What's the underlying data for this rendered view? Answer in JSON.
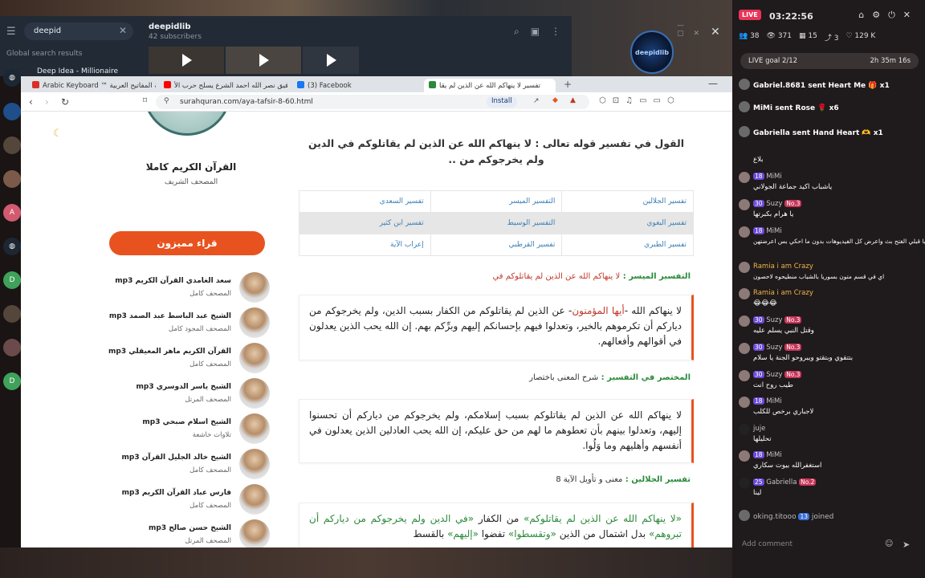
{
  "telegram": {
    "search_value": "deepid",
    "global_label": "Global search results",
    "result_title": "Deep Idea - Millionaire",
    "channel_name": "deepidlib",
    "subscribers": "42 subscribers",
    "logo_text": "deepidlib"
  },
  "browser": {
    "tabs": [
      {
        "label": "Arabic Keyboard ™ لوحة المفاتيح العربية",
        "color": "#d93025"
      },
      {
        "label": "رفيق نصر الله احمد الشرع يسلح حرب الأ",
        "color": "#ff0000"
      },
      {
        "label": "(3) Facebook",
        "color": "#1877f2"
      },
      {
        "label": "تفسير لا ينهاكم الله عن الذين لم يقا",
        "color": "#2a8a3a"
      }
    ],
    "url": "surahquran.com/aya-tafsir-8-60.html",
    "install_label": "Install"
  },
  "sidebar": {
    "title": "القرآن الكريم كاملا",
    "subtitle": "المصحف الشريف",
    "read_button": "قراء مميزون",
    "reciters": [
      {
        "name": "سعد الغامدي القرآن الكريم mp3",
        "desc": "المصحف كامل"
      },
      {
        "name": "الشيخ عبد الباسط عبد الصمد mp3",
        "desc": "المصحف المجود كامل"
      },
      {
        "name": "القرآن الكريم ماهر المعيقلي mp3",
        "desc": "المصحف كامل"
      },
      {
        "name": "الشيخ ياسر الدوسري mp3",
        "desc": "المصحف المرتل"
      },
      {
        "name": "الشيخ اسلام صبحي mp3",
        "desc": "تلاوات خاشعة"
      },
      {
        "name": "الشيخ خالد الجليل القرآن mp3",
        "desc": "المصحف كامل"
      },
      {
        "name": "فارس عباد القرآن الكريم mp3",
        "desc": "المصحف كامل"
      },
      {
        "name": "الشيخ حسن صالح mp3",
        "desc": "المصحف المرتل"
      }
    ]
  },
  "content": {
    "heading": "القول في تفسير قوله تعالى : لا ينهاكم الله عن الذين لم يقاتلوكم في الدين ولم يخرجوكم من ..",
    "table": [
      [
        "تفسير الجلالين",
        "التفسير الميسر",
        "تفسير السعدي"
      ],
      [
        "تفسير البغوي",
        "التفسير الوسيط",
        "تفسير ابن كثير"
      ],
      [
        "تفسير الطبري",
        "تفسير القرطبي",
        "إعراب الآية"
      ]
    ],
    "muyassar_label": "التفسير الميسر",
    "muyassar_desc": "لا ينهاكم الله عن الذين لم يقاتلوكم في",
    "muyassar_text_pre": "لا ينهاكم الله -",
    "muyassar_text_red": "أيها المؤمنون",
    "muyassar_text_post": "- عن الذين لم يقاتلوكم من الكفار بسبب الدين، ولم يخرجوكم من دياركم أن تكرموهم بالخير، وتعدلوا فيهم بإحسانكم إليهم وبرِّكم بهم. إن الله يحب الذين يعدلون في أقوالهم وأفعالهم.",
    "mukhtasar_label": "المختصر في التفسير",
    "mukhtasar_desc": "شرح المعنى باختصار",
    "mukhtasar_text": "لا ينهاكم الله عن الذين لم يقاتلوكم بسبب إسلامكم، ولم يخرجوكم من دياركم أن تحسنوا إليهم، وتعدلوا بينهم بأن تعطوهم ما لهم من حق عليكم، إن الله يحب العادلين الذين يعدلون في أنفسهم وأهليهم وما وَلُوا.",
    "jalalayn_label": "تفسير الجلالين",
    "jalalayn_desc": "معنى و تأويل الآية 8",
    "jalalayn_green1": "«لا ينهاكم الله عن الذين لم يقاتلوكم»",
    "jalalayn_mid1": " من الكفار ",
    "jalalayn_green2": "«في الدين ولم يخرجوكم من دياركم أن تبروهم»",
    "jalalayn_mid2": " بدل اشتمال من الذين ",
    "jalalayn_green3": "«وتقسطوا»",
    "jalalayn_mid3": " تفضوا ",
    "jalalayn_green4": "«إليهم»",
    "jalalayn_mid4": " بالقسط"
  },
  "live": {
    "badge": "LIVE",
    "time": "03:22:56",
    "stats": [
      "38",
      "371",
      "15",
      "3",
      "129 K"
    ],
    "goal_label": "LIVE goal",
    "goal_value": "2/12",
    "goal_time": "2h 35m 16s",
    "gifts": [
      {
        "text": "Gabriel.8681 sent Heart Me",
        "count": "x1"
      },
      {
        "text": "MiMi sent Rose",
        "count": "x6"
      },
      {
        "text": "Gabriella sent Hand Heart",
        "count": "x1"
      }
    ],
    "chat": [
      {
        "lvl": "18",
        "user": "MiMi",
        "msg": "بلاع"
      },
      {
        "lvl": "18",
        "user": "MiMi",
        "msg": "ياشباب اكيد جماعة الجولاني"
      },
      {
        "lvl": "30",
        "user": "Suzy",
        "msg": "يا هرام بكبرتها"
      },
      {
        "lvl": "18",
        "user": "MiMi",
        "msg": "سوريا قبلي الفتح بث واعرض كل الفيديوهات بدون ما احكي بس اعرضتهن"
      },
      {
        "lvl": "",
        "user": "Ramia i am Crazy",
        "msg": "اي في قسم متون بسوريا بالشباب منطيحوه لاحصون"
      },
      {
        "lvl": "",
        "user": "Ramia i am Crazy",
        "msg": "😂😂😂"
      },
      {
        "lvl": "30",
        "user": "Suzy",
        "msg": "وقتل النبي يسلم عليه"
      },
      {
        "lvl": "30",
        "user": "Suzy",
        "msg": "بتتقوي وبتقتو ويبروحو الجنة يا سلام"
      },
      {
        "lvl": "30",
        "user": "Suzy",
        "msg": "طيب روح انت"
      },
      {
        "lvl": "18",
        "user": "MiMi",
        "msg": "لاجباري برخص للكلب"
      },
      {
        "lvl": "",
        "user": "juje",
        "msg": "تحليلها"
      },
      {
        "lvl": "18",
        "user": "MiMi",
        "msg": "استغفرالله بيوت سكاري"
      },
      {
        "lvl": "25",
        "user": "Gabriella",
        "msg": "لينا"
      }
    ],
    "joined_user": "oking.titooo",
    "joined_text": "joined",
    "comment_placeholder": "Add comment"
  }
}
